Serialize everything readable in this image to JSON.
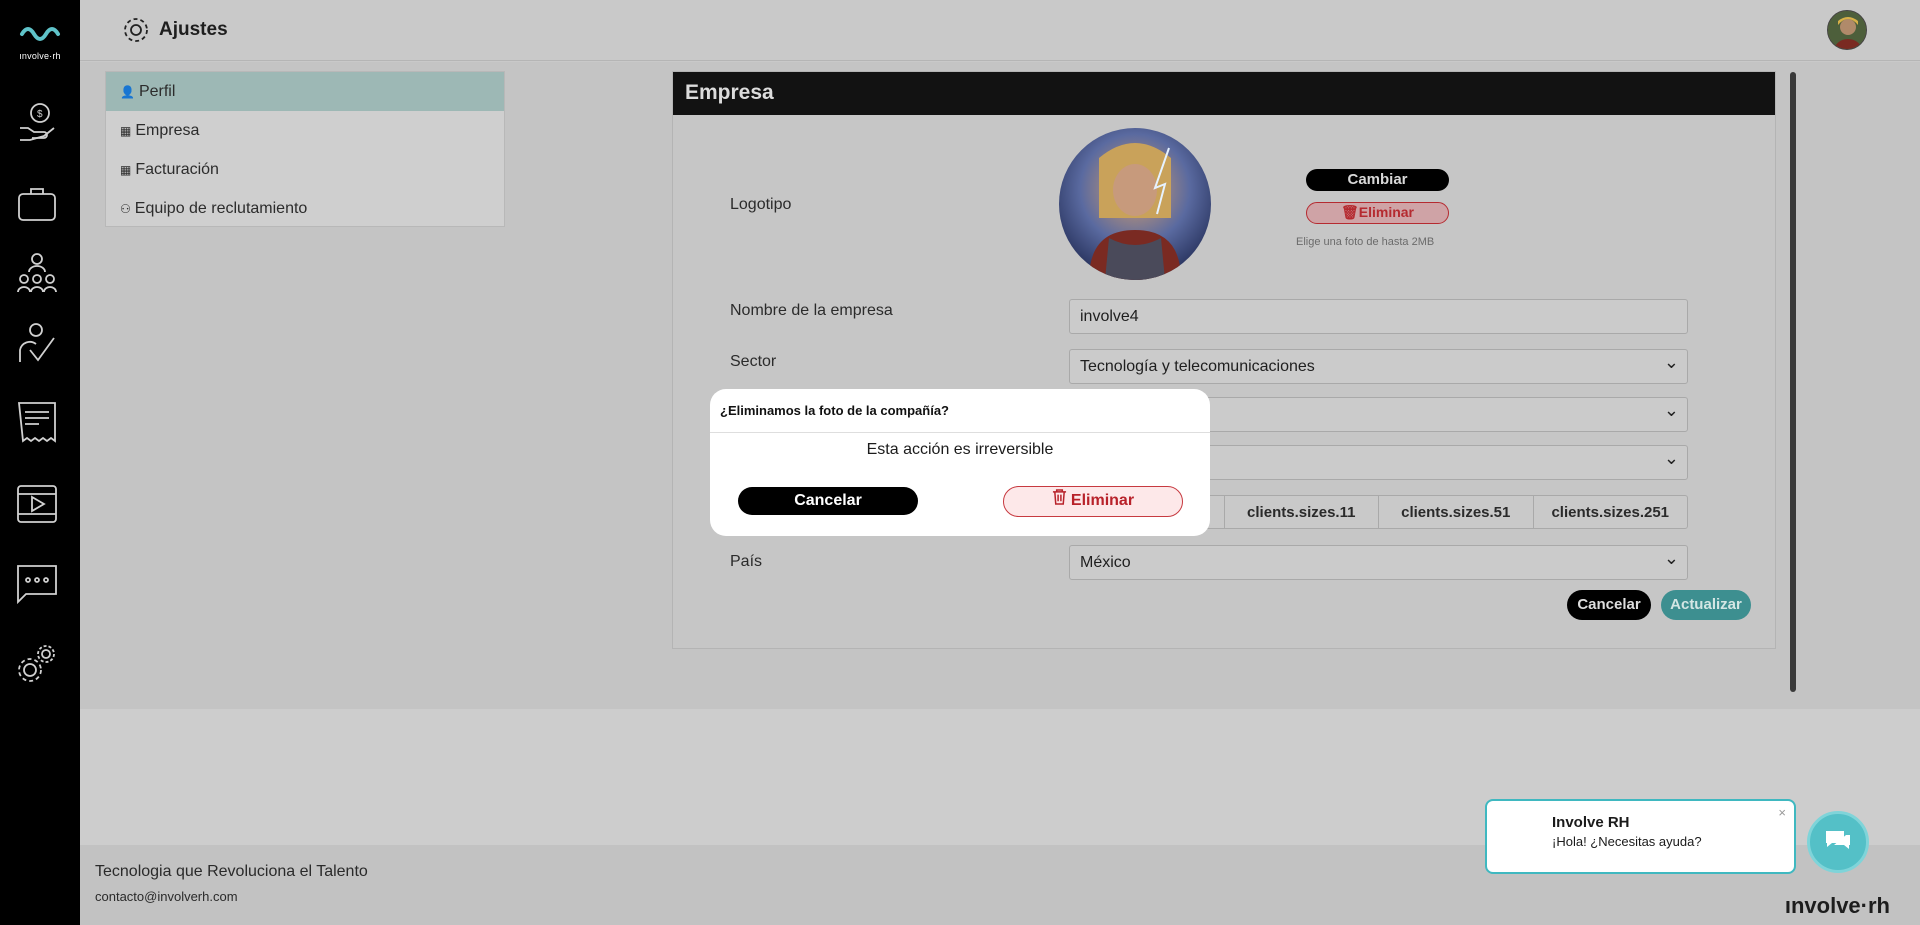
{
  "app": {
    "logo_text": "ınvolve·rh",
    "page_title": "Ajustes"
  },
  "rail": {
    "icons": [
      "payments-icon",
      "briefcase-icon",
      "team-icon",
      "approvals-icon",
      "invoice-icon",
      "video-icon",
      "chat-icon",
      "settings-icon"
    ]
  },
  "settings_menu": {
    "items": [
      {
        "label": "Perfil",
        "icon": "user-icon"
      },
      {
        "label": "Empresa",
        "icon": "building-icon"
      },
      {
        "label": "Facturación",
        "icon": "building-icon"
      },
      {
        "label": "Equipo de reclutamiento",
        "icon": "team-icon"
      }
    ],
    "active": "Perfil"
  },
  "company_panel": {
    "title": "Empresa",
    "logo_label": "Logotipo",
    "change_button": "Cambiar",
    "delete_button": "Eliminar",
    "photo_hint": "Elige una foto de hasta 2MB",
    "name_label": "Nombre de la empresa",
    "name_value": "involve4",
    "sector_label": "Sector",
    "sector_value": "Tecnología y telecomunicaciones",
    "sizes": [
      "clients.sizes.11",
      "clients.sizes.51",
      "clients.sizes.251"
    ],
    "country_label": "País",
    "country_value": "México",
    "cancel_button": "Cancelar",
    "update_button": "Actualizar"
  },
  "modal": {
    "title": "¿Eliminamos la foto de la compañía?",
    "message": "Esta acción es irreversible",
    "cancel": "Cancelar",
    "confirm": "Eliminar"
  },
  "footer": {
    "tagline": "Tecnologia que Revoluciona el Talento",
    "email": "contacto@involverh.com",
    "brand": "ınvolve·rh"
  },
  "chat": {
    "name": "Involve RH",
    "message": "¡Hola! ¿Necesitas ayuda?",
    "close": "×"
  },
  "colors": {
    "accent": "#3d8f90",
    "danger": "#b52a30",
    "chat": "#54c0c7"
  }
}
